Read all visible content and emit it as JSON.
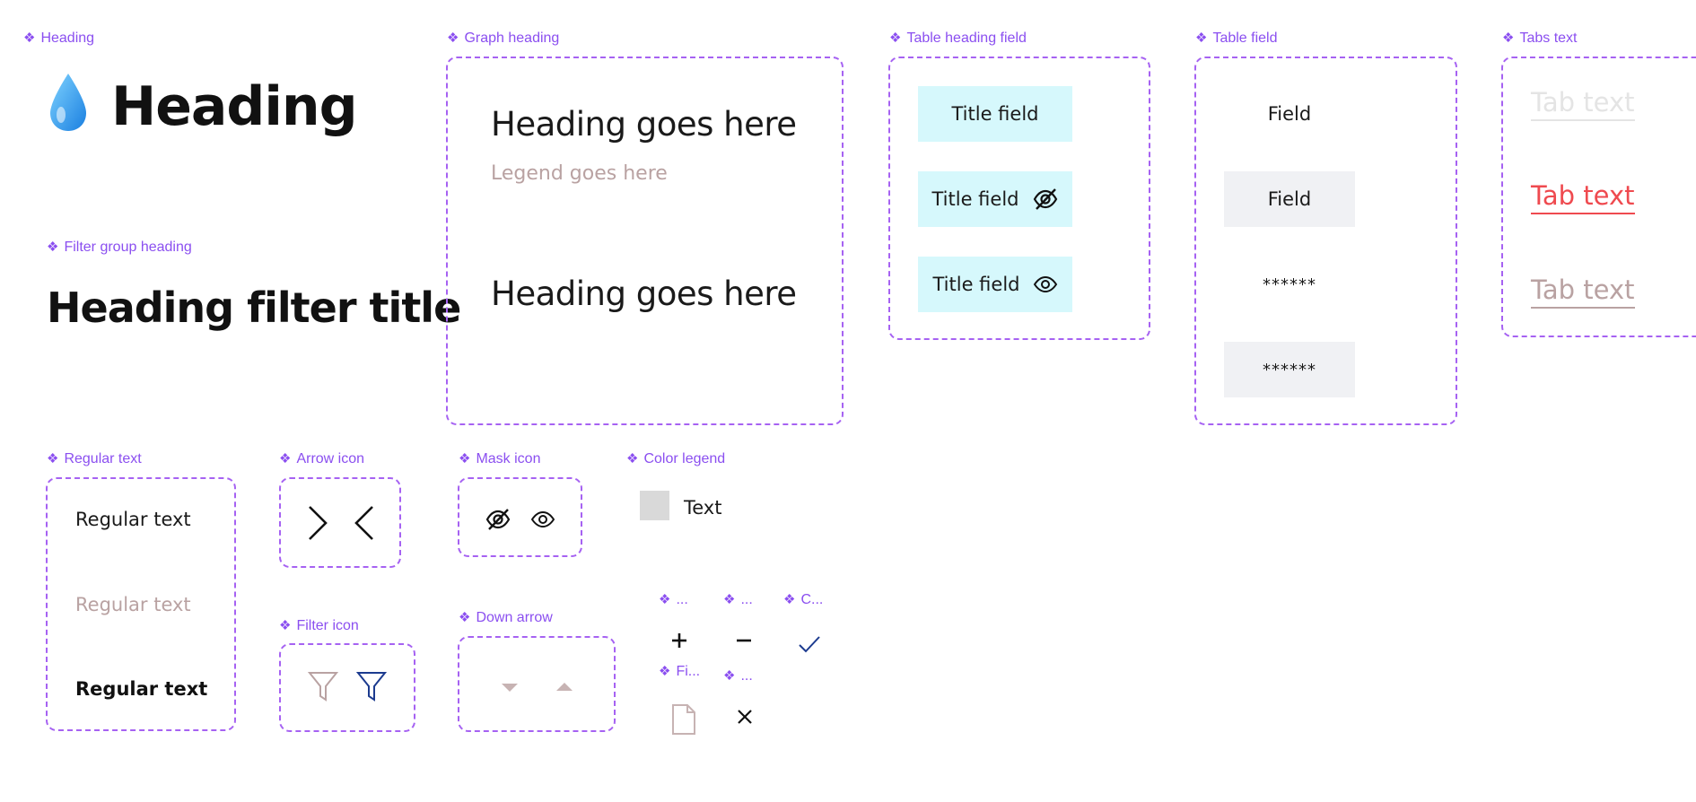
{
  "labels": {
    "heading": "Heading",
    "graph_heading": "Graph heading",
    "table_heading_field": "Table heading field",
    "table_field": "Table field",
    "tabs_text": "Tabs text",
    "filter_group_heading": "Filter group heading",
    "regular_text": "Regular text",
    "arrow_icon": "Arrow icon",
    "mask_icon": "Mask icon",
    "color_legend": "Color legend",
    "filter_icon": "Filter icon",
    "down_arrow": "Down arrow",
    "plus": "...",
    "minus": "...",
    "check": "C...",
    "file": "Fi...",
    "close": "..."
  },
  "heading": {
    "emoji": "💧",
    "text": "Heading"
  },
  "filter_group": {
    "title": "Heading filter title"
  },
  "graph": {
    "heading_1": "Heading goes here",
    "legend": "Legend goes here",
    "heading_2": "Heading goes here"
  },
  "table_heading": {
    "cells": [
      "Title field",
      "Title field",
      "Title field"
    ]
  },
  "table_field": {
    "cells": [
      "Field",
      "Field",
      "******",
      "******"
    ]
  },
  "tabs": {
    "items": [
      "Tab text",
      "Tab text",
      "Tab text"
    ]
  },
  "regular": {
    "items": [
      "Regular text",
      "Regular text",
      "Regular text"
    ]
  },
  "color_legend": {
    "text": "Text",
    "swatch_color": "#d9d9d9"
  },
  "colors": {
    "accent": "#8b4ff0",
    "frame": "#a662f2",
    "cyan": "#d6f8fc",
    "grey": "#f0f1f4",
    "muted": "#b9a2a2",
    "red": "#ef4a4f",
    "navy": "#1c3b8f"
  }
}
